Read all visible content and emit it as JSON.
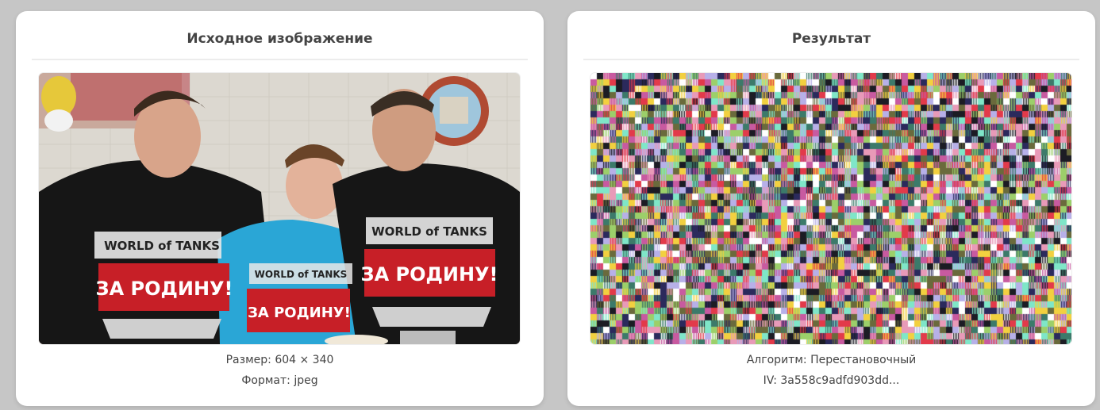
{
  "source_panel": {
    "title": "Исходное изображение",
    "image_alt": "Исходное изображение",
    "size_label": "Размер:",
    "size_value": "604 × 340",
    "format_label": "Формат:",
    "format_value": "jpeg",
    "shirt_logo": "WORLD of TANKS",
    "shirt_slogan": "ЗА РОДИНУ!"
  },
  "result_panel": {
    "title": "Результат",
    "image_alt": "Результат",
    "algorithm_label": "Алгоритм:",
    "algorithm_value": "Перестановочный",
    "iv_label": "IV:",
    "iv_value": "3a558c9adfd903dd..."
  },
  "colors": {
    "page_bg": "#c6c6c6",
    "card_bg": "#ffffff",
    "title_text": "#444444",
    "noise_palette": [
      "#6a6a3c",
      "#b7b0e8",
      "#7fe6c8",
      "#e23a4a",
      "#2b2a5c",
      "#f2d040",
      "#9ccf6a",
      "#ffffff",
      "#c85aa0",
      "#3c7a6a",
      "#e89ab8",
      "#1c1c24"
    ]
  }
}
